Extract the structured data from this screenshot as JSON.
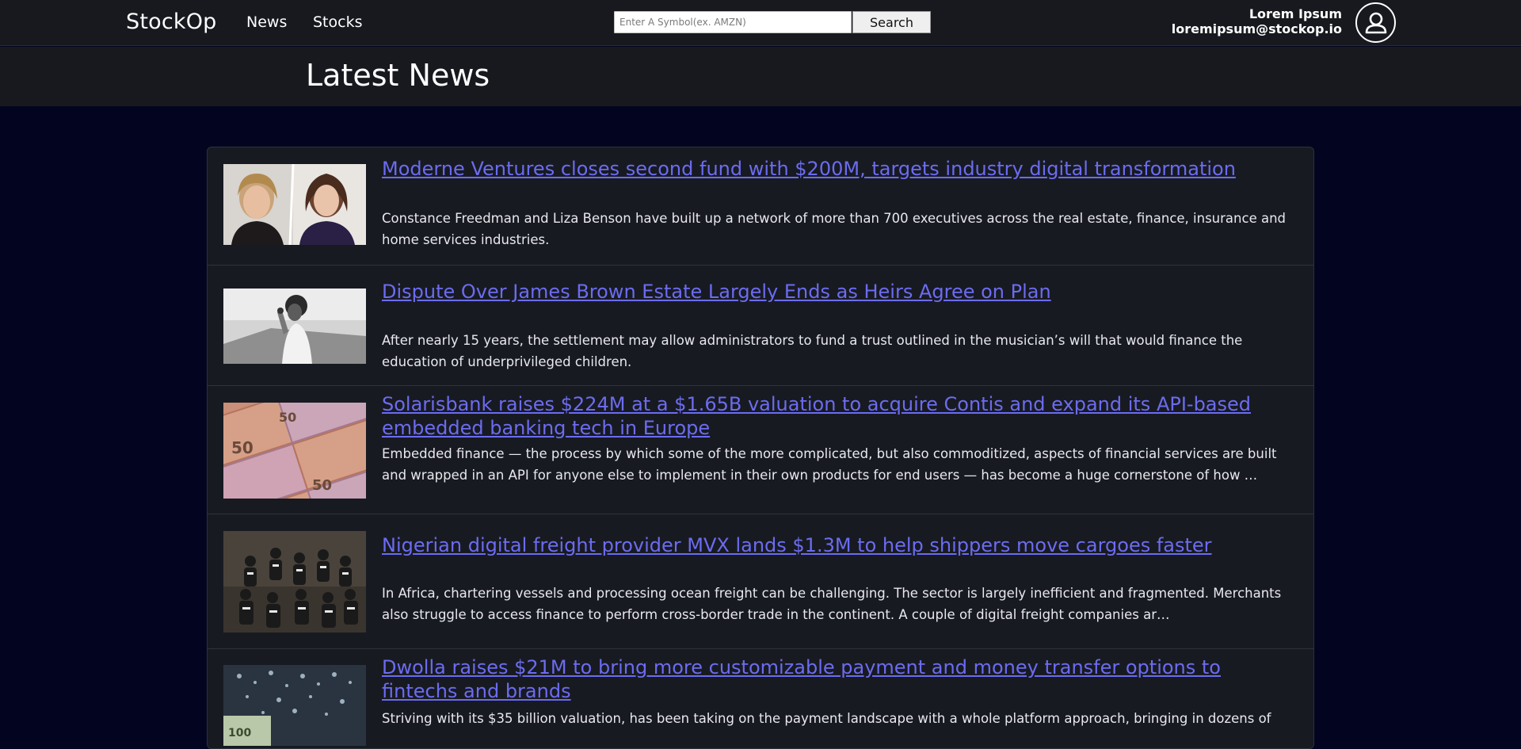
{
  "nav": {
    "brand": "StockOp",
    "links": [
      "News",
      "Stocks"
    ],
    "search_placeholder": "Enter A Symbol(ex. AMZN)",
    "search_button": "Search",
    "user_name": "Lorem Ipsum",
    "user_email": "loremipsum@stockop.io",
    "avatar_icon": "user-icon"
  },
  "page": {
    "title": "Latest News"
  },
  "news": [
    {
      "headline": "Moderne Ventures closes second fund with $200M, targets industry digital transformation",
      "summary": "Constance Freedman and Liza Benson have built up a network of more than 700 executives across the real estate, finance, insurance and home services industries."
    },
    {
      "headline": "Dispute Over James Brown Estate Largely Ends as Heirs Agree on Plan",
      "summary": "After nearly 15 years, the settlement may allow administrators to fund a trust outlined in the musician’s will that would finance the education of underprivileged children."
    },
    {
      "headline": "Solarisbank raises $224M at a $1.65B valuation to acquire Contis and expand its API-based embedded banking tech in Europe",
      "summary": "Embedded finance — the process by which some of the more complicated, but also commoditized, aspects of financial services are built and wrapped in an API for anyone else to implement in their own products for end users — has become a huge cornerstone of how …"
    },
    {
      "headline": "Nigerian digital freight provider MVX lands $1.3M to help shippers move cargoes faster",
      "summary": "In Africa, chartering vessels and processing ocean freight can be challenging. The sector is largely inefficient and fragmented. Merchants also struggle to access finance to perform cross-border trade in the continent. A couple of digital freight companies ar…"
    },
    {
      "headline": "Dwolla raises $21M to bring more customizable payment and money transfer options to fintechs and brands",
      "summary": "Striving with its $35 billion valuation, has been taking on the payment landscape with a whole platform approach, bringing in dozens of"
    }
  ],
  "colors": {
    "page_background": "#030520",
    "bar_background": "#17191f",
    "card_background": "#181a22",
    "link": "#6b6cf0"
  }
}
